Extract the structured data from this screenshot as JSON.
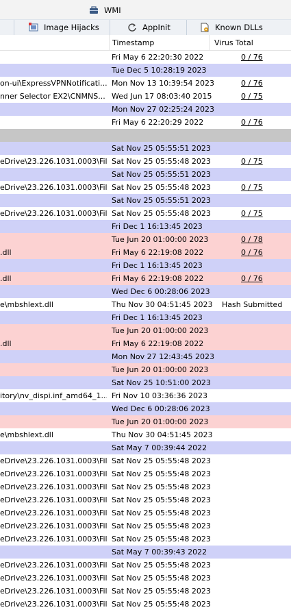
{
  "tabs_top": [
    {
      "label": "WMI",
      "icon": "wmi-icon"
    }
  ],
  "tabs_second": [
    {
      "label": "Image Hijacks",
      "icon": "image-hijacks-icon"
    },
    {
      "label": "AppInit",
      "icon": "appinit-icon"
    },
    {
      "label": "Known DLLs",
      "icon": "known-dlls-icon"
    }
  ],
  "columns": {
    "timestamp": "Timestamp",
    "virus_total": "Virus Total"
  },
  "colors": {
    "blue_row": "#cfd1f8",
    "pink_row": "#fcd2d2",
    "gray_row": "#c6c6c6",
    "white_row": "#ffffff"
  },
  "rows": [
    {
      "path": "",
      "timestamp": "Fri May  6 22:20:30 2022",
      "vt": "0 / 76",
      "bg": "white"
    },
    {
      "path": "",
      "timestamp": "Tue Dec  5 10:28:19 2023",
      "vt": "",
      "bg": "blue"
    },
    {
      "path": "on-ui\\ExpressVPNNotificati...",
      "timestamp": "Mon Nov 13 10:39:54 2023",
      "vt": "0 / 76",
      "bg": "white"
    },
    {
      "path": "nner Selector EX2\\CNMNS...",
      "timestamp": "Wed Jun 17 08:03:40 2015",
      "vt": "0 / 75",
      "bg": "white"
    },
    {
      "path": "",
      "timestamp": "Mon Nov 27 02:25:24 2023",
      "vt": "",
      "bg": "blue"
    },
    {
      "path": "",
      "timestamp": "Fri May  6 22:20:29 2022",
      "vt": "0 / 76",
      "bg": "white"
    },
    {
      "path": "",
      "timestamp": "",
      "vt": "",
      "bg": "gray"
    },
    {
      "path": "",
      "timestamp": "Sat Nov 25 05:55:51 2023",
      "vt": "",
      "bg": "blue"
    },
    {
      "path": "eDrive\\23.226.1031.0003\\Fil...",
      "timestamp": "Sat Nov 25 05:55:48 2023",
      "vt": "0 / 75",
      "bg": "white"
    },
    {
      "path": "",
      "timestamp": "Sat Nov 25 05:55:51 2023",
      "vt": "",
      "bg": "blue"
    },
    {
      "path": "eDrive\\23.226.1031.0003\\Fil...",
      "timestamp": "Sat Nov 25 05:55:48 2023",
      "vt": "0 / 75",
      "bg": "white"
    },
    {
      "path": "",
      "timestamp": "Sat Nov 25 05:55:51 2023",
      "vt": "",
      "bg": "blue"
    },
    {
      "path": "eDrive\\23.226.1031.0003\\Fil...",
      "timestamp": "Sat Nov 25 05:55:48 2023",
      "vt": "0 / 75",
      "bg": "white"
    },
    {
      "path": "",
      "timestamp": "Fri Dec  1 16:13:45 2023",
      "vt": "",
      "bg": "blue"
    },
    {
      "path": "",
      "timestamp": "Tue Jun 20 01:00:00 2023",
      "vt": "0 / 78",
      "bg": "pink"
    },
    {
      "path": ".dll",
      "timestamp": "Fri May  6 22:19:08 2022",
      "vt": "0 / 76",
      "bg": "pink"
    },
    {
      "path": "",
      "timestamp": "Fri Dec  1 16:13:45 2023",
      "vt": "",
      "bg": "blue"
    },
    {
      "path": ".dll",
      "timestamp": "Fri May  6 22:19:08 2022",
      "vt": "0 / 76",
      "bg": "pink"
    },
    {
      "path": "",
      "timestamp": "Wed Dec  6 00:28:06 2023",
      "vt": "",
      "bg": "blue"
    },
    {
      "path": "e\\mbshlext.dll",
      "timestamp": "Thu Nov 30 04:51:45 2023",
      "vt": "Hash Submitted",
      "bg": "white",
      "plain": true
    },
    {
      "path": "",
      "timestamp": "Fri Dec  1 16:13:45 2023",
      "vt": "",
      "bg": "blue"
    },
    {
      "path": "",
      "timestamp": "Tue Jun 20 01:00:00 2023",
      "vt": "",
      "bg": "pink"
    },
    {
      "path": ".dll",
      "timestamp": "Fri May  6 22:19:08 2022",
      "vt": "",
      "bg": "pink"
    },
    {
      "path": "",
      "timestamp": "Mon Nov 27 12:43:45 2023",
      "vt": "",
      "bg": "blue"
    },
    {
      "path": "",
      "timestamp": "Tue Jun 20 01:00:00 2023",
      "vt": "",
      "bg": "pink"
    },
    {
      "path": "",
      "timestamp": "Sat Nov 25 10:51:00 2023",
      "vt": "",
      "bg": "blue"
    },
    {
      "path": "itory\\nv_dispi.inf_amd64_1...",
      "timestamp": "Fri Nov 10 03:36:36 2023",
      "vt": "",
      "bg": "white"
    },
    {
      "path": "",
      "timestamp": "Wed Dec  6 00:28:06 2023",
      "vt": "",
      "bg": "blue"
    },
    {
      "path": "",
      "timestamp": "Tue Jun 20 01:00:00 2023",
      "vt": "",
      "bg": "pink"
    },
    {
      "path": "e\\mbshlext.dll",
      "timestamp": "Thu Nov 30 04:51:45 2023",
      "vt": "",
      "bg": "white"
    },
    {
      "path": "",
      "timestamp": "Sat May  7 00:39:44 2022",
      "vt": "",
      "bg": "blue"
    },
    {
      "path": "eDrive\\23.226.1031.0003\\Fil...",
      "timestamp": "Sat Nov 25 05:55:48 2023",
      "vt": "",
      "bg": "white"
    },
    {
      "path": "eDrive\\23.226.1031.0003\\Fil...",
      "timestamp": "Sat Nov 25 05:55:48 2023",
      "vt": "",
      "bg": "white"
    },
    {
      "path": "eDrive\\23.226.1031.0003\\Fil...",
      "timestamp": "Sat Nov 25 05:55:48 2023",
      "vt": "",
      "bg": "white"
    },
    {
      "path": "eDrive\\23.226.1031.0003\\Fil...",
      "timestamp": "Sat Nov 25 05:55:48 2023",
      "vt": "",
      "bg": "white"
    },
    {
      "path": "eDrive\\23.226.1031.0003\\Fil...",
      "timestamp": "Sat Nov 25 05:55:48 2023",
      "vt": "",
      "bg": "white"
    },
    {
      "path": "eDrive\\23.226.1031.0003\\Fil...",
      "timestamp": "Sat Nov 25 05:55:48 2023",
      "vt": "",
      "bg": "white"
    },
    {
      "path": "eDrive\\23.226.1031.0003\\Fil...",
      "timestamp": "Sat Nov 25 05:55:48 2023",
      "vt": "",
      "bg": "white"
    },
    {
      "path": "",
      "timestamp": "Sat May  7 00:39:43 2022",
      "vt": "",
      "bg": "blue"
    },
    {
      "path": "eDrive\\23.226.1031.0003\\Fil...",
      "timestamp": "Sat Nov 25 05:55:48 2023",
      "vt": "",
      "bg": "white"
    },
    {
      "path": "eDrive\\23.226.1031.0003\\Fil...",
      "timestamp": "Sat Nov 25 05:55:48 2023",
      "vt": "",
      "bg": "white"
    },
    {
      "path": "eDrive\\23.226.1031.0003\\Fil...",
      "timestamp": "Sat Nov 25 05:55:48 2023",
      "vt": "",
      "bg": "white"
    },
    {
      "path": "eDrive\\23.226.1031.0003\\Fil...",
      "timestamp": "Sat Nov 25 05:55:48 2023",
      "vt": "",
      "bg": "white"
    }
  ]
}
